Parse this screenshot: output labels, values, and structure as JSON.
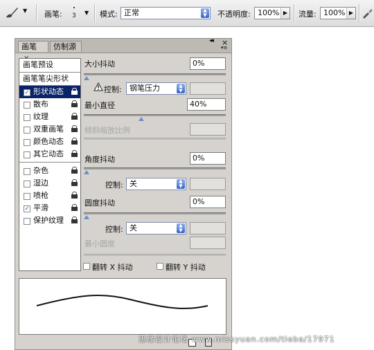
{
  "options_bar": {
    "brush_label": "画笔:",
    "brush_size": "3",
    "mode_label": "模式:",
    "mode_value": "正常",
    "opacity_label": "不透明度:",
    "opacity_value": "100%",
    "flow_label": "流量:",
    "flow_value": "100%"
  },
  "panel": {
    "tabs": [
      {
        "label": "画笔"
      },
      {
        "label": "仿制源"
      }
    ],
    "list": {
      "preset": "画笔预设",
      "tip_shape": "画笔笔尖形状",
      "items": [
        {
          "label": "形状动态",
          "checked": true,
          "selected": true
        },
        {
          "label": "散布",
          "checked": false
        },
        {
          "label": "纹理",
          "checked": false
        },
        {
          "label": "双重画笔",
          "checked": false
        },
        {
          "label": "颜色动态",
          "checked": false
        },
        {
          "label": "其它动态",
          "checked": false
        },
        {
          "label": "杂色",
          "checked": false
        },
        {
          "label": "湿边",
          "checked": false
        },
        {
          "label": "喷枪",
          "checked": false
        },
        {
          "label": "平滑",
          "checked": true
        },
        {
          "label": "保护纹理",
          "checked": false
        }
      ]
    },
    "size_jitter": {
      "label": "大小抖动",
      "value": "0%",
      "level": 0
    },
    "control1": {
      "label": "控制:",
      "value": "钢笔压力"
    },
    "min_diameter": {
      "label": "最小直径",
      "value": "40%",
      "level": 0.4
    },
    "tilt_scale": {
      "label": "倾斜缩放比例"
    },
    "angle_jitter": {
      "label": "角度抖动",
      "value": "0%",
      "level": 0
    },
    "control2": {
      "label": "控制:",
      "value": "关"
    },
    "roundness_jitter": {
      "label": "圆度抖动",
      "value": "0%",
      "level": 0
    },
    "control3": {
      "label": "控制:",
      "value": "关"
    },
    "min_roundness": {
      "label": "最小圆度"
    },
    "flip_x": {
      "label": "翻转 X 抖动",
      "checked": false
    },
    "flip_y": {
      "label": "翻转 Y 抖动",
      "checked": false
    }
  },
  "watermark": "思缘设计论坛  www.missyuan.com/tieba/17971",
  "colors": {
    "panel_bg": "#d6d3ce",
    "selected_bg": "#0a246a",
    "thumb": "#6d8fc7"
  },
  "icons": {
    "brush_tool": "brush-icon",
    "airbrush": "airbrush-icon",
    "warning": "warning-icon",
    "lock": "lock-icon",
    "panel_menu": "panel-menu-icon"
  }
}
